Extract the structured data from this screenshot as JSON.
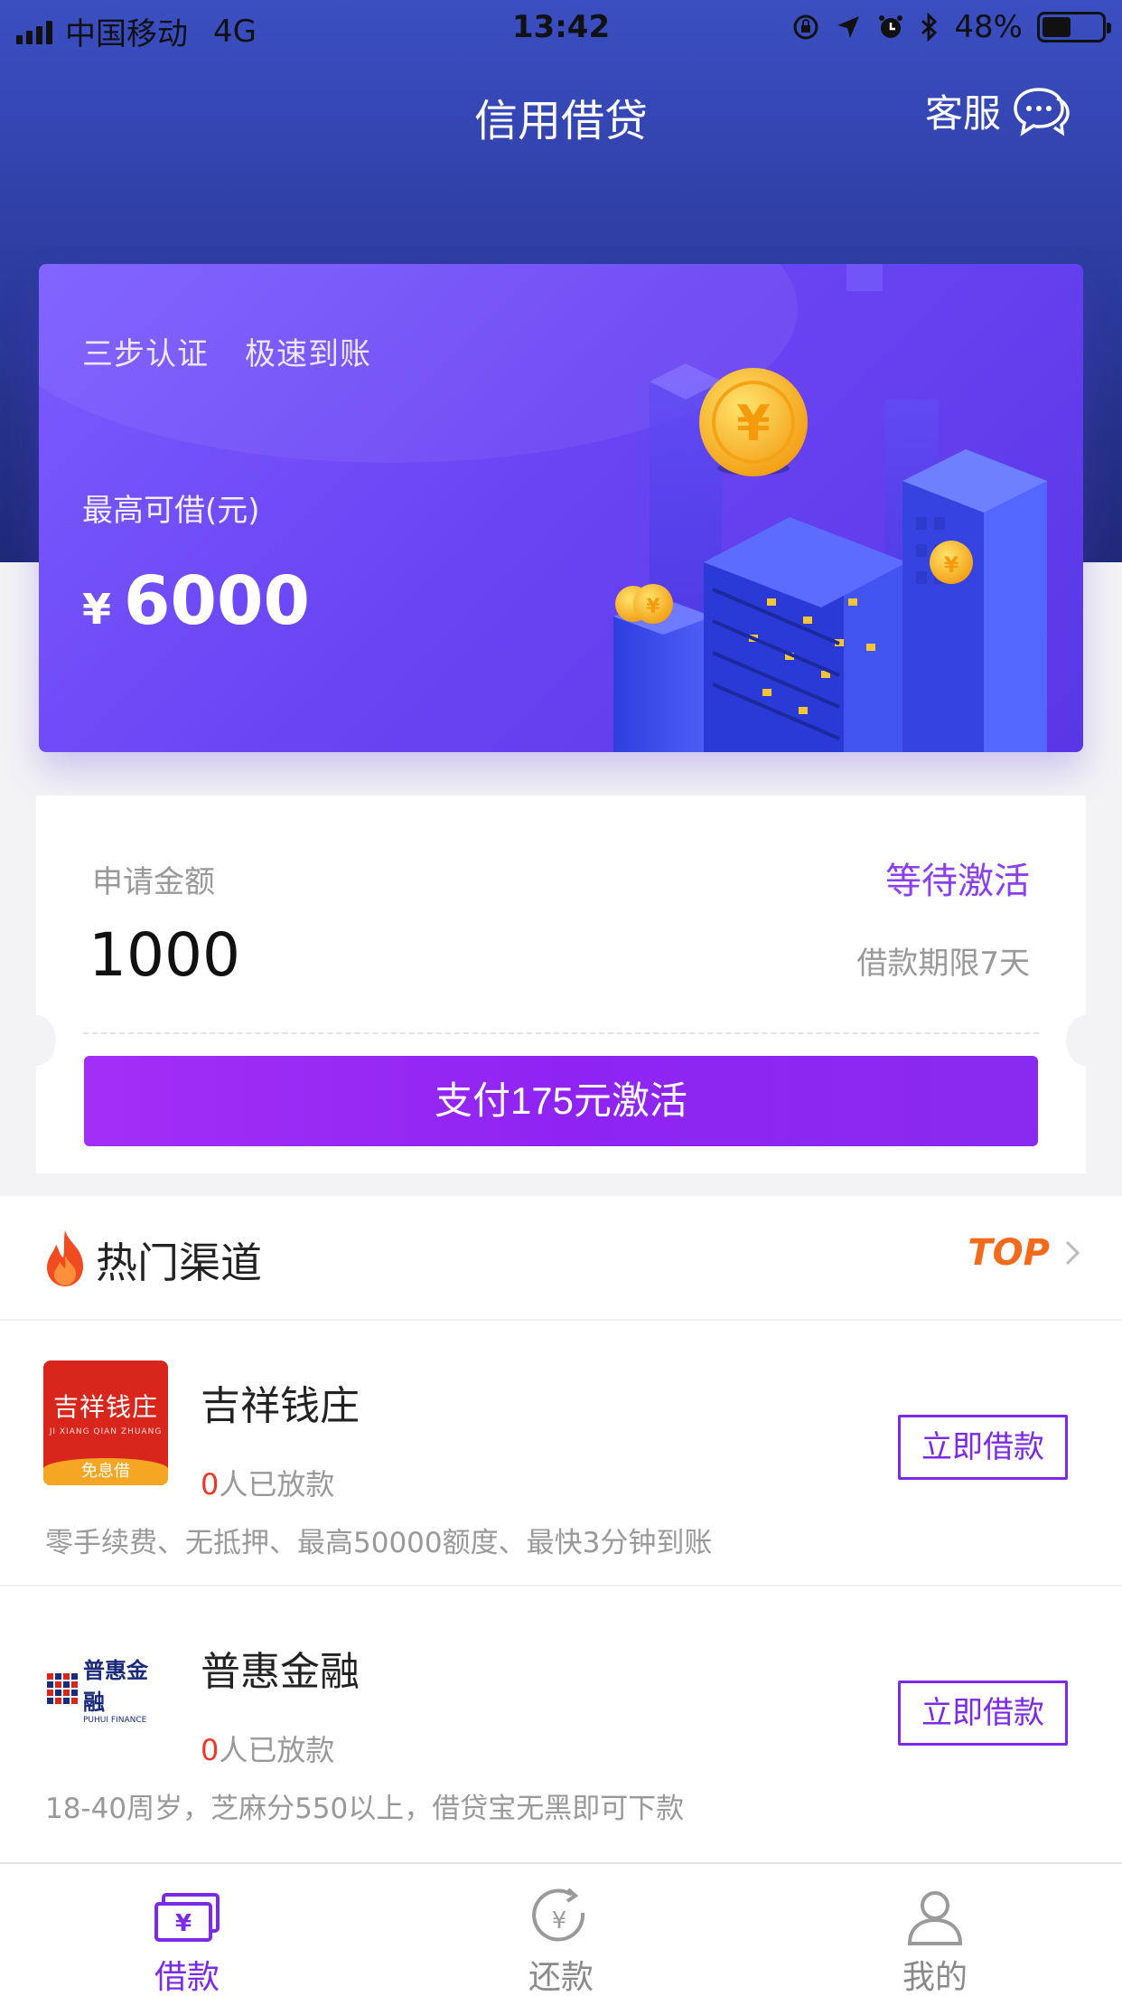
{
  "status_bar": {
    "carrier": "中国移动",
    "network": "4G",
    "time": "13:42",
    "battery": "48%",
    "battery_level": 0.48
  },
  "nav": {
    "title": "信用借贷",
    "service_label": "客服"
  },
  "hero": {
    "tagline_1": "三步认证",
    "tagline_2": "极速到账",
    "max_label": "最高可借(元)",
    "currency": "¥",
    "amount": "6000"
  },
  "apply": {
    "label": "申请金额",
    "status": "等待激活",
    "amount": "1000",
    "term": "借款期限7天",
    "button": "支付175元激活"
  },
  "channels": {
    "title": "热门渠道",
    "top_label": "TOP",
    "items": [
      {
        "name": "吉祥钱庄",
        "logo_main": "吉祥钱庄",
        "logo_sub": "JI XIANG QIAN ZHUANG",
        "logo_tag": "免息借",
        "count": "0",
        "count_suffix": "人已放款",
        "desc": "零手续费、无抵押、最高50000额度、最快3分钟到账",
        "button": "立即借款"
      },
      {
        "name": "普惠金融",
        "logo_main": "普惠金融",
        "logo_sub": "PUHUI FINANCE",
        "count": "0",
        "count_suffix": "人已放款",
        "desc": "18-40周岁，芝麻分550以上，借贷宝无黑即可下款",
        "button": "立即借款"
      }
    ]
  },
  "tabbar": {
    "tabs": [
      {
        "label": "借款",
        "icon": "loan-icon",
        "active": true
      },
      {
        "label": "还款",
        "icon": "repay-icon",
        "active": false
      },
      {
        "label": "我的",
        "icon": "profile-icon",
        "active": false
      }
    ]
  },
  "colors": {
    "accent": "#8a2af0",
    "header": "#3b4fc2",
    "hero": "#6a45f4",
    "count_zero": "#f0352b",
    "top": "#f26b1d"
  }
}
